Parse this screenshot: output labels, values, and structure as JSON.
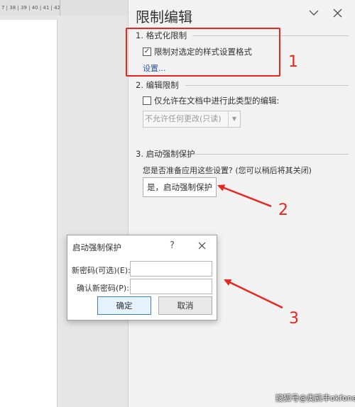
{
  "ruler": {
    "text": "7 | 38 | 39 | 40 | 41 | 42"
  },
  "pane": {
    "title": "限制编辑",
    "collapse_icon": "chevron-down-icon",
    "close_icon": "close-icon",
    "section1": {
      "heading": "1. 格式化限制",
      "checkbox_label": "限制对选定的样式设置格式",
      "checked": true,
      "settings_link": "设置..."
    },
    "section2": {
      "heading": "2. 编辑限制",
      "checkbox_label": "仅允许在文档中进行此类型的编辑:",
      "checked": false,
      "select_value": "不允许任何更改(只读)"
    },
    "section3": {
      "heading": "3. 启动强制保护",
      "question": "您是否准备应用这些设置? (您可以稍后将其关闭)",
      "start_button": "是，启动强制保护"
    }
  },
  "dialog": {
    "title": "启动强制保护",
    "help": "?",
    "new_password_label": "新密码(可选)(E):",
    "confirm_password_label": "确认新密码(P):",
    "ok_button": "确定",
    "cancel_button": "取消"
  },
  "annotations": {
    "color": "#e8251e",
    "step1": "1",
    "step2": "2",
    "step3": "3"
  },
  "watermark": "搜狐号@奥凯丰okfone"
}
